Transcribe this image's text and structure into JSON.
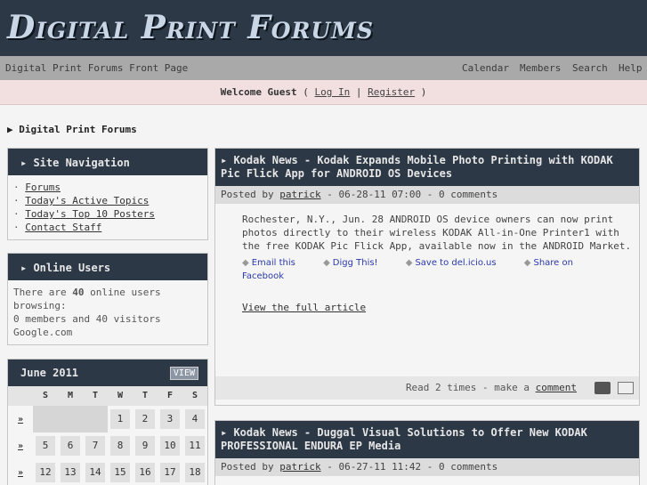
{
  "site": {
    "logo": "Digital Print Forums"
  },
  "navbar": {
    "front": "Digital Print Forums  Front Page",
    "links": [
      "Calendar",
      "Members",
      "Search",
      "Help"
    ]
  },
  "welcome": {
    "text": "Welcome Guest",
    "login": "Log In",
    "register": "Register"
  },
  "breadcrumb": "▶ Digital Print Forums",
  "site_nav": {
    "title": "Site Navigation",
    "items": [
      "Forums",
      "Today's Active Topics",
      "Today's Top 10 Posters",
      "Contact Staff"
    ]
  },
  "online": {
    "title": "Online Users",
    "pre": "There are ",
    "count": "40",
    "post": " online users browsing:",
    "line2": "0 members and 40 visitors",
    "line3": "Google.com"
  },
  "calendar": {
    "title": "June 2011",
    "view": "VIEW",
    "days": [
      "S",
      "M",
      "T",
      "W",
      "T",
      "F",
      "S"
    ],
    "week_link": "»",
    "rows": [
      [
        "",
        "",
        "",
        "1",
        "2",
        "3",
        "4"
      ],
      [
        "5",
        "6",
        "7",
        "8",
        "9",
        "10",
        "11"
      ],
      [
        "12",
        "13",
        "14",
        "15",
        "16",
        "17",
        "18"
      ]
    ]
  },
  "posts": [
    {
      "title": "Kodak News - Kodak Expands Mobile Photo Printing with KODAK Pic Flick App for ANDROID OS Devices",
      "posted_by": "Posted by",
      "author": "patrick",
      "meta": " - 06-28-11 07:00 - 0 comments",
      "body": "Rochester, N.Y., Jun. 28 ANDROID OS device owners can now print photos directly to their wireless KODAK All-in-One Printer1 with the free KODAK Pic Flick App, available now in the ANDROID Market.",
      "share": [
        "Email this",
        "Digg This!",
        "Save to del.icio.us",
        "Share on Facebook"
      ],
      "more": "View the full article",
      "read": "Read 2 times - make a ",
      "comment": "comment"
    },
    {
      "title": "Kodak News - Duggal Visual Solutions to Offer New KODAK PROFESSIONAL ENDURA EP Media",
      "posted_by": "Posted by",
      "author": "patrick",
      "meta": " - 06-27-11 11:42 - 0 comments"
    }
  ]
}
